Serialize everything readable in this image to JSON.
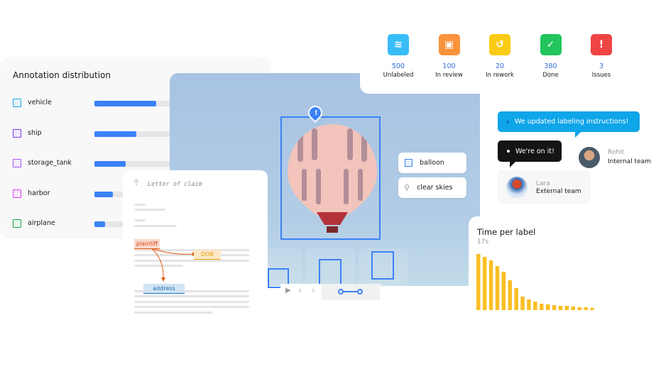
{
  "distribution": {
    "title": "Annotation distribution",
    "items": [
      {
        "label": "vehicle",
        "color": "#1ea7e8",
        "fill": "#e3f4fc",
        "value": 0.58
      },
      {
        "label": "ship",
        "color": "#7c3aed",
        "fill": "#efe9fb",
        "value": 0.39
      },
      {
        "label": "storage_tank",
        "color": "#a855f7",
        "fill": "#f3eafc",
        "value": 0.29
      },
      {
        "label": "harbor",
        "color": "#d946ef",
        "fill": "#f8e8fb",
        "value": 0.17
      },
      {
        "label": "airplane",
        "color": "#16a34a",
        "fill": "#e5f6ea",
        "value": 0.1
      }
    ]
  },
  "stats": [
    {
      "value": "500",
      "label": "Unlabeled",
      "color": "#38bdf8",
      "icon": "layers-icon"
    },
    {
      "value": "100",
      "label": "In review",
      "color": "#fb923c",
      "icon": "clipboard-review-icon"
    },
    {
      "value": "20",
      "label": "In rework",
      "color": "#facc15",
      "icon": "clipboard-rework-icon"
    },
    {
      "value": "380",
      "label": "Done",
      "color": "#22c55e",
      "icon": "clipboard-check-icon"
    },
    {
      "value": "3",
      "label": "Issues",
      "color": "#ef4444",
      "icon": "alert-icon"
    }
  ],
  "image_labels": [
    {
      "label": "balloon",
      "icon": "bounding-box-icon"
    },
    {
      "label": "clear skies",
      "icon": "classification-icon"
    }
  ],
  "letter": {
    "title": "Letter of claim",
    "tags": {
      "plaintiff": "plaintiff",
      "dob": "DOB",
      "address": "address"
    }
  },
  "chat": {
    "announcement": "We updated labeling instructions!",
    "reply": "We're on it!",
    "users": [
      {
        "name": "Rohit",
        "team": "Internal team"
      },
      {
        "name": "Lara",
        "team": "External team"
      }
    ]
  },
  "chart_data": {
    "type": "bar",
    "title": "Time per label",
    "subtitle": "17s",
    "values": [
      79,
      75,
      70,
      62,
      54,
      42,
      31,
      19,
      15,
      12,
      9,
      8,
      7,
      6,
      6,
      5,
      4,
      4,
      3
    ],
    "color": "#fbbf24"
  }
}
